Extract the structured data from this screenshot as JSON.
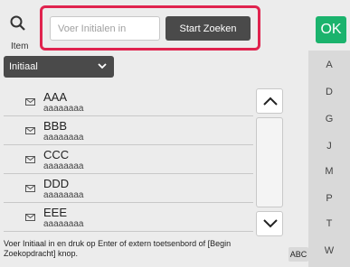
{
  "item_button": {
    "label": "Item",
    "icon": "search-icon"
  },
  "search": {
    "placeholder": "Voer Initialen in",
    "value": "",
    "button_label": "Start Zoeken"
  },
  "ok_button": {
    "label": "OK"
  },
  "dropdown": {
    "selected": "Initiaal",
    "icon": "chevron-down-icon"
  },
  "entries": [
    {
      "name": "AAA",
      "sub": "aaaaaaaa"
    },
    {
      "name": "BBB",
      "sub": "aaaaaaaa"
    },
    {
      "name": "CCC",
      "sub": "aaaaaaaa"
    },
    {
      "name": "DDD",
      "sub": "aaaaaaaa"
    },
    {
      "name": "EEE",
      "sub": "aaaaaaaa"
    }
  ],
  "alphabet_index": [
    "A",
    "D",
    "G",
    "J",
    "M",
    "P",
    "T",
    "W"
  ],
  "footer": {
    "message": "Voer Initiaal in en druk op Enter of extern toetsenbord of [Begin Zoekopdracht] knop.",
    "abc_label": "ABC"
  },
  "colors": {
    "accent_red": "#e0234e",
    "ok_green": "#1bb36d",
    "dark_button": "#4a4a4a"
  }
}
